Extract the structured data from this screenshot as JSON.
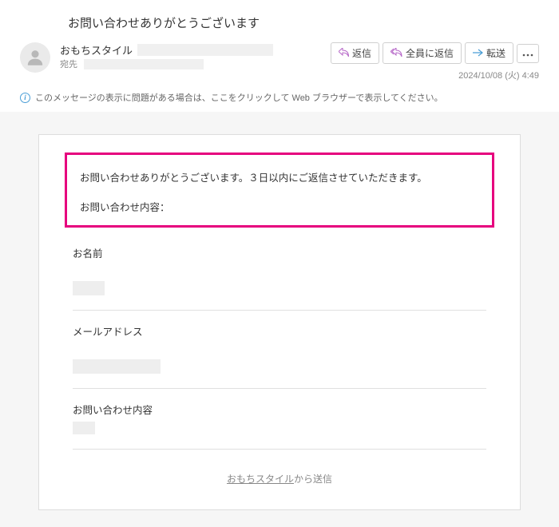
{
  "header": {
    "subject": "お問い合わせありがとうございます",
    "sender_name": "おもちスタイル",
    "to_label": "宛先",
    "timestamp": "2024/10/08 (火) 4:49",
    "actions": {
      "reply": "返信",
      "reply_all": "全員に返信",
      "forward": "転送"
    }
  },
  "notice": "このメッセージの表示に問題がある場合は、ここをクリックして Web ブラウザーで表示してください。",
  "body": {
    "highlight_main": "お問い合わせありがとうございます。３日以内にご返信させていただきます。",
    "highlight_sub": "お問い合わせ内容：",
    "fields": {
      "name_label": "お名前",
      "email_label": "メールアドレス",
      "inquiry_label": "お問い合わせ内容"
    },
    "footer_link": "おもちスタイル",
    "footer_suffix": "から送信"
  }
}
